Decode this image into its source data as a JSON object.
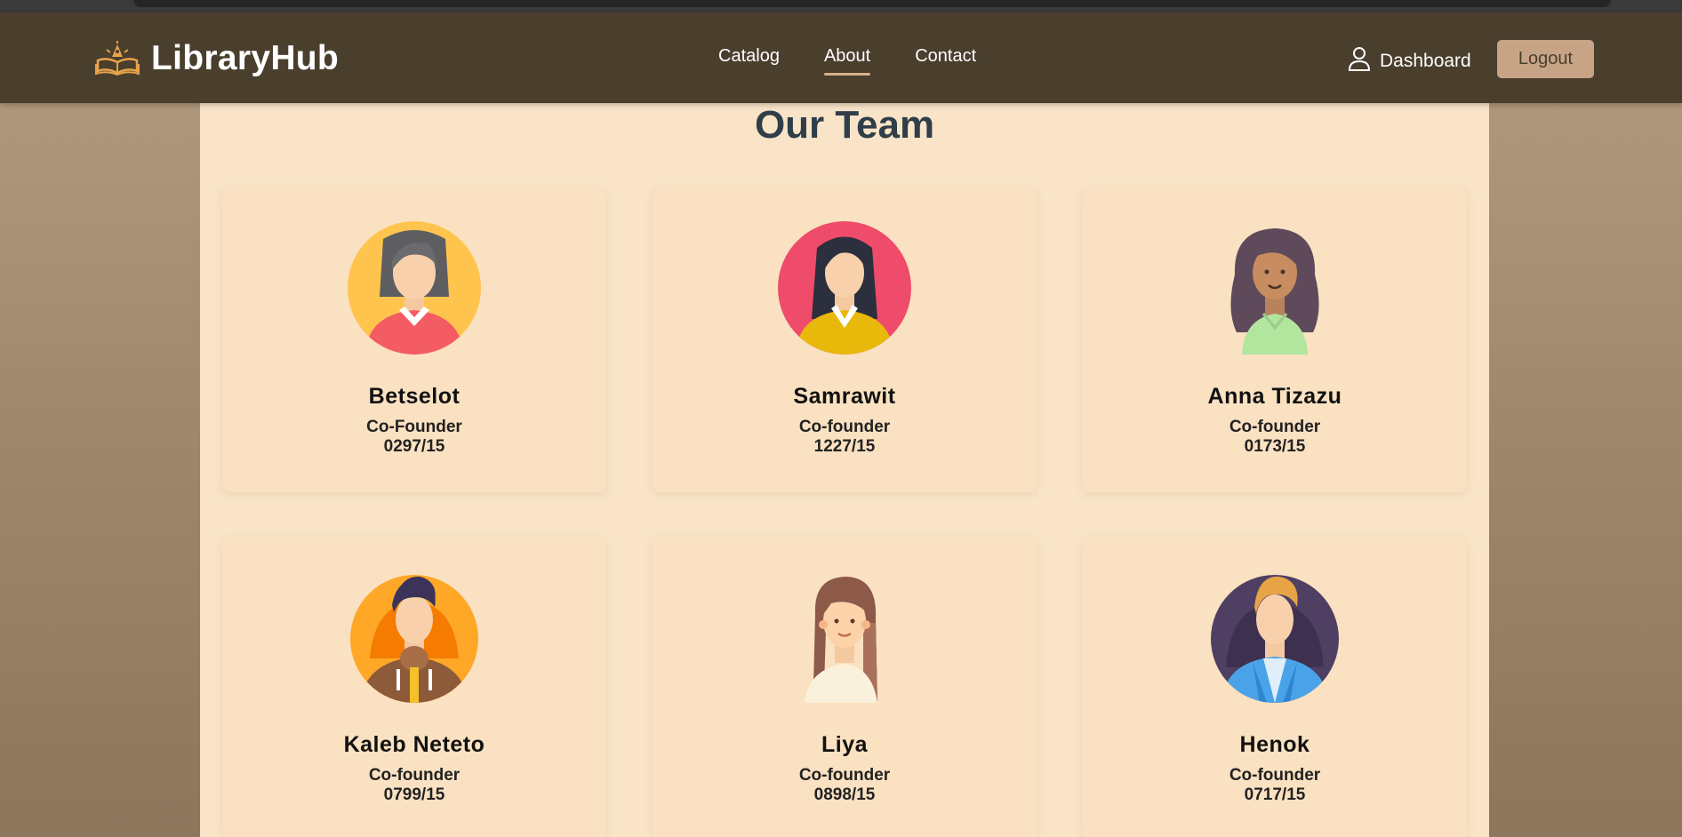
{
  "header": {
    "brand_name": "LibraryHub",
    "logo_icon": "book-lamp-logo-icon",
    "nav": [
      {
        "label": "Catalog",
        "active": false
      },
      {
        "label": "About",
        "active": true
      },
      {
        "label": "Contact",
        "active": false
      }
    ],
    "dashboard_label": "Dashboard",
    "logout_label": "Logout"
  },
  "section": {
    "title": "Our Team"
  },
  "team": [
    {
      "name": "Betselot",
      "role": "Co-Founder",
      "id": "0297/15",
      "avatar": "woman-gray-hair-avatar-icon"
    },
    {
      "name": "Samrawit",
      "role": "Co-founder",
      "id": "1227/15",
      "avatar": "woman-black-hair-avatar-icon"
    },
    {
      "name": "Anna Tizazu",
      "role": "Co-founder",
      "id": "0173/15",
      "avatar": "woman-curly-hair-avatar-icon"
    },
    {
      "name": "Kaleb Neteto",
      "role": "Co-founder",
      "id": "0799/15",
      "avatar": "man-hoodie-avatar-icon"
    },
    {
      "name": "Liya",
      "role": "Co-founder",
      "id": "0898/15",
      "avatar": "woman-long-hair-avatar-icon"
    },
    {
      "name": "Henok",
      "role": "Co-founder",
      "id": "0717/15",
      "avatar": "man-blonde-avatar-icon"
    }
  ],
  "colors": {
    "navbar": "#4a3e2d",
    "content_bg": "#f9e4c8",
    "card_bg": "#fae1c1",
    "logout_bg": "#c8a487",
    "active_underline": "#d9b08c"
  }
}
